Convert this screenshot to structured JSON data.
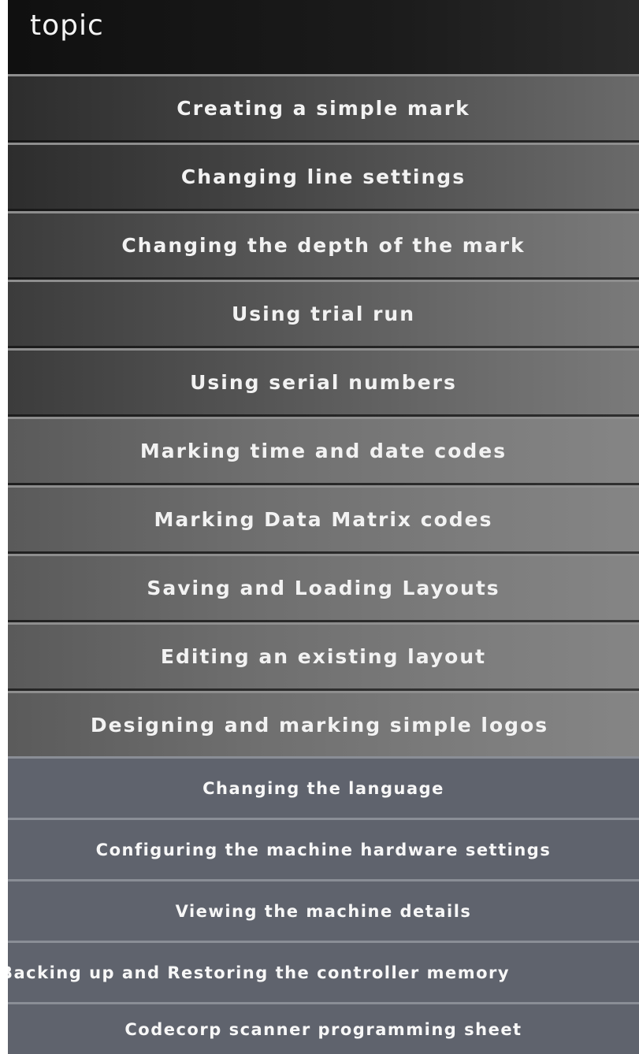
{
  "header": {
    "title": "topic"
  },
  "topics": [
    {
      "label": "Creating a simple mark"
    },
    {
      "label": "Changing line settings"
    },
    {
      "label": "Changing the depth of the mark"
    },
    {
      "label": "Using trial run"
    },
    {
      "label": "Using serial numbers"
    },
    {
      "label": "Marking time and date codes"
    },
    {
      "label": "Marking Data Matrix codes"
    },
    {
      "label": "Saving and Loading Layouts"
    },
    {
      "label": "Editing an existing layout"
    },
    {
      "label": "Designing and marking simple logos"
    },
    {
      "label": "Changing the language"
    },
    {
      "label": "Configuring the machine hardware settings"
    },
    {
      "label": "Viewing the machine details"
    },
    {
      "label": "Backing up and Restoring the controller memory"
    },
    {
      "label": "Codecorp scanner programming sheet"
    }
  ]
}
